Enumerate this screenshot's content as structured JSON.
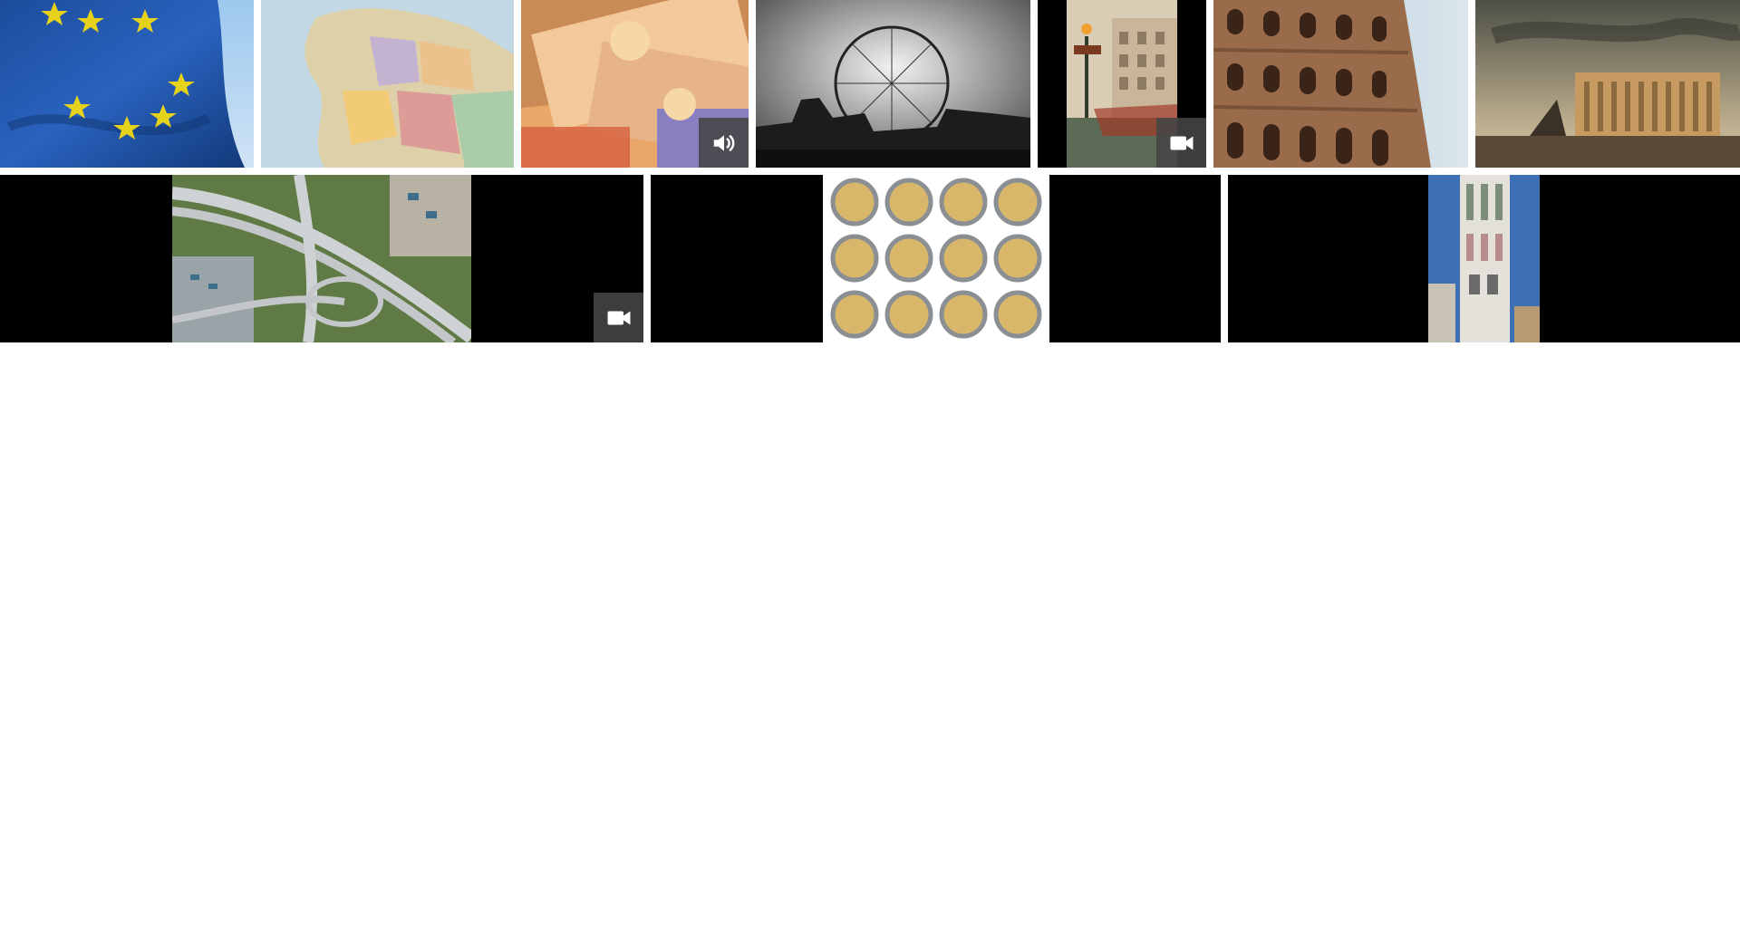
{
  "gallery": {
    "items": [
      {
        "subject": "eu-flag",
        "media": "image"
      },
      {
        "subject": "europe-map",
        "media": "image"
      },
      {
        "subject": "euro-banknotes",
        "media": "audio",
        "badge_icon": "speaker-icon"
      },
      {
        "subject": "london-eye",
        "media": "image"
      },
      {
        "subject": "paris-metro",
        "media": "video",
        "badge_icon": "video-camera-icon"
      },
      {
        "subject": "colosseum",
        "media": "image"
      },
      {
        "subject": "vittoriano-rome",
        "media": "image"
      },
      {
        "subject": "highway-interchange",
        "media": "video",
        "badge_icon": "video-camera-icon"
      },
      {
        "subject": "euro-coins",
        "media": "image"
      },
      {
        "subject": "florence-bell-tower",
        "media": "image"
      }
    ]
  },
  "colors": {
    "page_background": "#ffffff",
    "letterbox": "#000000",
    "badge_background": "#464646",
    "badge_icon": "#ffffff",
    "eu_blue": "#1f4fa8",
    "eu_star": "#e6d21a"
  }
}
